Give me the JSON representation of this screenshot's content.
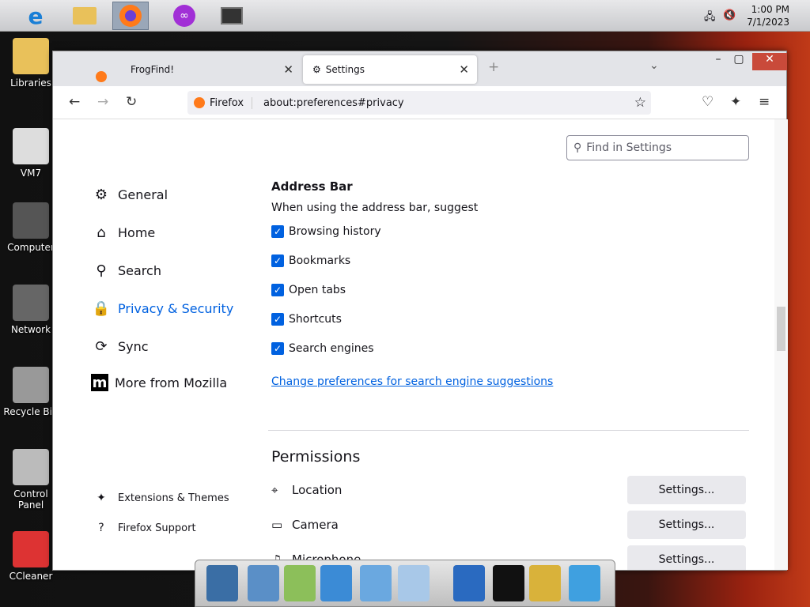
{
  "taskbar": {
    "clock_time": "1:00 PM",
    "clock_date": "7/1/2023",
    "icons": [
      "ie-icon",
      "folder-icon",
      "firefox-icon",
      "app-icon",
      "media-icon"
    ]
  },
  "desktop": {
    "icons": [
      {
        "label": "Libraries",
        "color": "#e9c15a"
      },
      {
        "label": "VM7",
        "color": "#ddd"
      },
      {
        "label": "Computer",
        "color": "#555"
      },
      {
        "label": "Network",
        "color": "#666"
      },
      {
        "label": "Recycle Bin",
        "color": "#999"
      },
      {
        "label": "Control Panel",
        "color": "#bbb"
      },
      {
        "label": "CCleaner",
        "color": "#d33"
      }
    ]
  },
  "browser": {
    "tabs": [
      {
        "label": "FrogFind!"
      },
      {
        "label": "Settings"
      }
    ],
    "identity_label": "Firefox",
    "url": "about:preferences#privacy"
  },
  "settings": {
    "search_placeholder": "Find in Settings",
    "nav": [
      {
        "label": "General",
        "icon": "⚙"
      },
      {
        "label": "Home",
        "icon": "⌂"
      },
      {
        "label": "Search",
        "icon": "⚲"
      },
      {
        "label": "Privacy & Security",
        "icon": "🔒"
      },
      {
        "label": "Sync",
        "icon": "⟳"
      },
      {
        "label": "More from Mozilla",
        "icon": "m"
      }
    ],
    "footer_nav": [
      {
        "label": "Extensions & Themes"
      },
      {
        "label": "Firefox Support"
      }
    ],
    "address_bar": {
      "heading": "Address Bar",
      "intro": "When using the address bar, suggest",
      "options": [
        "Browsing history",
        "Bookmarks",
        "Open tabs",
        "Shortcuts",
        "Search engines"
      ],
      "link": "Change preferences for search engine suggestions"
    },
    "permissions": {
      "heading": "Permissions",
      "items": [
        {
          "label": "Location",
          "button": "Settings..."
        },
        {
          "label": "Camera",
          "button": "Settings..."
        },
        {
          "label": "Microphone",
          "button": "Settings..."
        }
      ]
    }
  },
  "colors": {
    "accent": "#0061e0",
    "checkbox": "#0061e0"
  }
}
